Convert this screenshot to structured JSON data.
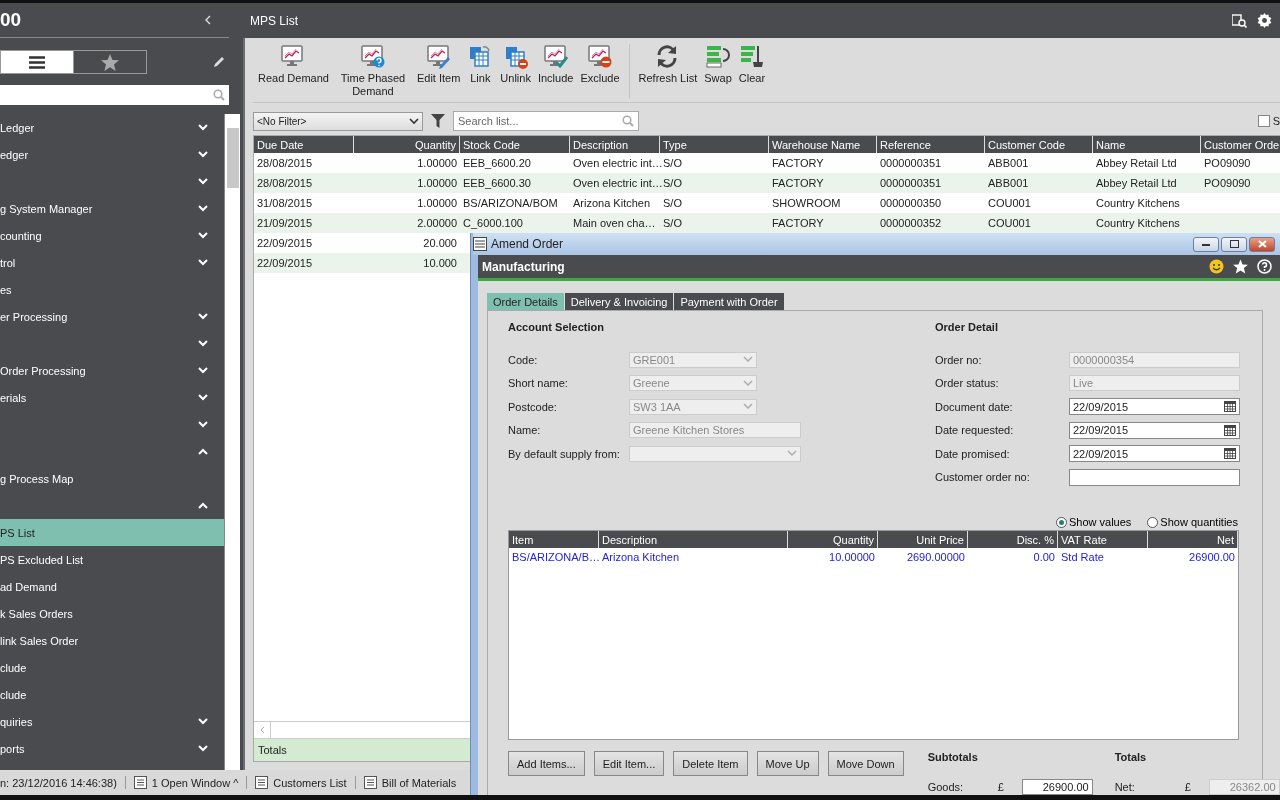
{
  "app": {
    "logo_text": "00"
  },
  "sidebar": {
    "view_toggle": [
      {
        "selected": true
      },
      {
        "selected": false
      }
    ],
    "items": [
      {
        "kind": "group",
        "label": "Ledger",
        "expanded": false
      },
      {
        "kind": "group",
        "label": "edger",
        "expanded": false
      },
      {
        "kind": "group",
        "expanded": false
      },
      {
        "kind": "group",
        "label": "g System Manager",
        "expanded": false
      },
      {
        "kind": "group",
        "label": "counting",
        "expanded": false
      },
      {
        "kind": "group",
        "label": "trol",
        "expanded": false
      },
      {
        "kind": "link",
        "label": "es",
        "selected": false
      },
      {
        "kind": "group",
        "label": "er Processing",
        "expanded": false
      },
      {
        "kind": "group",
        "expanded": false
      },
      {
        "kind": "group",
        "label": "Order Processing",
        "expanded": false
      },
      {
        "kind": "group",
        "label": "erials",
        "expanded": false
      },
      {
        "kind": "group",
        "expanded": false
      },
      {
        "kind": "group",
        "expanded": true,
        "children": [
          {
            "kind": "link",
            "label": "g Process Map",
            "selected": false
          },
          {
            "kind": "group",
            "expanded": true,
            "children": [
              {
                "kind": "link",
                "label": "PS List",
                "selected": true
              },
              {
                "kind": "link",
                "label": "PS Excluded List",
                "selected": false
              },
              {
                "kind": "link",
                "label": "ad Demand",
                "selected": false
              },
              {
                "kind": "link",
                "label": "k Sales Orders",
                "selected": false
              },
              {
                "kind": "link",
                "label": "link Sales Order",
                "selected": false
              },
              {
                "kind": "link",
                "label": "clude",
                "selected": false
              },
              {
                "kind": "link",
                "label": "clude",
                "selected": false
              }
            ]
          },
          {
            "kind": "group",
            "label": "quiries",
            "expanded": false
          },
          {
            "kind": "group",
            "label": "ports",
            "expanded": false
          }
        ]
      }
    ]
  },
  "page": {
    "title": "MPS List"
  },
  "toolbar": {
    "groups": [
      [
        {
          "label": "Read Demand"
        },
        {
          "label": "Time Phased Demand"
        },
        {
          "label": "Edit Item"
        },
        {
          "label": "Link"
        },
        {
          "label": "Unlink"
        },
        {
          "label": "Include"
        },
        {
          "label": "Exclude"
        }
      ],
      [
        {
          "label": "Refresh List"
        },
        {
          "label": "Swap"
        },
        {
          "label": "Clear"
        }
      ]
    ]
  },
  "filter": {
    "value": "<No Filter>"
  },
  "search": {
    "placeholder": "Search list..."
  },
  "show_checkbox": {
    "label": "S",
    "checked": false
  },
  "table": {
    "columns": [
      "Due Date",
      "Quantity",
      "Stock Code",
      "Description",
      "Type",
      "Warehouse Name",
      "Reference",
      "Customer Code",
      "Name",
      "Customer Orde"
    ],
    "rows": [
      [
        "28/08/2015",
        "1.00000",
        "EEB_6600.20",
        "Oven electric int…",
        "S/O",
        "FACTORY",
        "0000000351",
        "ABB001",
        "Abbey Retail Ltd",
        "PO09090"
      ],
      [
        "28/08/2015",
        "1.00000",
        "EEB_6600.30",
        "Oven electric int…",
        "S/O",
        "FACTORY",
        "0000000351",
        "ABB001",
        "Abbey Retail Ltd",
        "PO09090"
      ],
      [
        "31/08/2015",
        "1.00000",
        "BS/ARIZONA/BOM",
        "Arizona Kitchen",
        "S/O",
        "SHOWROOM",
        "0000000350",
        "COU001",
        "Country Kitchens"
      ],
      [
        "21/09/2015",
        "2.00000",
        "C_6000.100",
        "Main oven cha…",
        "S/O",
        "FACTORY",
        "0000000352",
        "COU001",
        "Country Kitchens"
      ],
      [
        "22/09/2015",
        "20.000"
      ],
      [
        "22/09/2015",
        "10.000"
      ]
    ],
    "totals_label": "Totals"
  },
  "status_bar": {
    "login": "n: 23/12/2016 14:46:38)",
    "items": [
      {
        "label": "1 Open Window ^"
      },
      {
        "label": "Customers List"
      },
      {
        "label": "Bill of Materials"
      }
    ]
  },
  "dialog": {
    "title": "Amend Order",
    "header": "Manufacturing",
    "tabs": [
      {
        "label": "Order Details",
        "selected": true
      },
      {
        "label": "Delivery & Invoicing",
        "selected": false
      },
      {
        "label": "Payment with Order",
        "selected": false
      }
    ],
    "account_selection": {
      "title": "Account Selection",
      "fields": [
        {
          "label": "Code:",
          "value": "GRE001",
          "kind": "dropdown"
        },
        {
          "label": "Short name:",
          "value": "Greene",
          "kind": "dropdown"
        },
        {
          "label": "Postcode:",
          "value": "SW3 1AA",
          "kind": "dropdown"
        },
        {
          "label": "Name:",
          "value": "Greene Kitchen Stores",
          "kind": "readonly"
        },
        {
          "label": "By default supply from:",
          "kind": "wide-dropdown"
        }
      ]
    },
    "order_detail": {
      "title": "Order Detail",
      "fields": [
        {
          "label": "Order no:",
          "value": "0000000354",
          "kind": "readonly"
        },
        {
          "label": "Order status:",
          "value": "Live",
          "kind": "readonly"
        },
        {
          "label": "Document date:",
          "value": "22/09/2015",
          "kind": "date"
        },
        {
          "label": "Date requested:",
          "value": "22/09/2015",
          "kind": "date"
        },
        {
          "label": "Date promised:",
          "value": "22/09/2015",
          "kind": "date"
        },
        {
          "label": "Customer order no:",
          "kind": "text"
        }
      ]
    },
    "view_options": [
      {
        "label": "Show values",
        "selected": true
      },
      {
        "label": "Show quantities",
        "selected": false
      }
    ],
    "items_grid": {
      "columns": [
        "Item",
        "Description",
        "Quantity",
        "Unit Price",
        "Disc. %",
        "VAT Rate",
        "Net"
      ],
      "rows": [
        [
          "BS/ARIZONA/B…",
          "Arizona Kitchen",
          "10.00000",
          "2690.00000",
          "0.00",
          "Std Rate",
          "26900.00"
        ]
      ]
    },
    "buttons": [
      {
        "label": "Add Items..."
      },
      {
        "label": "Edit Item..."
      },
      {
        "label": "Delete Item"
      },
      {
        "label": "Move Up"
      },
      {
        "label": "Move Down"
      }
    ],
    "subtotals": {
      "title": "Subtotals",
      "fields": [
        {
          "label": "Goods:",
          "currency": "£",
          "value": "26900.00",
          "kind": "text"
        }
      ]
    },
    "totals": {
      "title": "Totals",
      "fields": [
        {
          "label": "Net:",
          "currency": "£",
          "value": "26362.00",
          "kind": "readonly"
        }
      ]
    }
  }
}
